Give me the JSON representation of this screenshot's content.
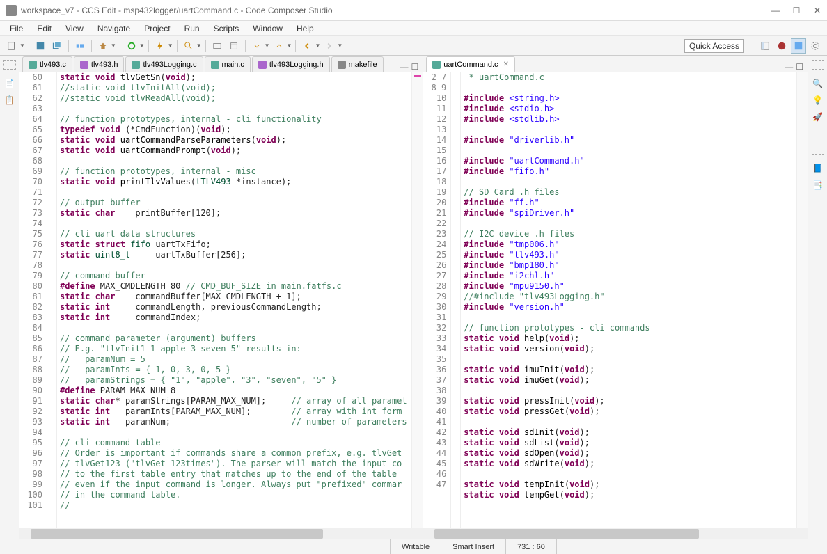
{
  "window": {
    "title": "workspace_v7 - CCS Edit - msp432logger/uartCommand.c - Code Composer Studio"
  },
  "menu": [
    "File",
    "Edit",
    "View",
    "Navigate",
    "Project",
    "Run",
    "Scripts",
    "Window",
    "Help"
  ],
  "quickAccess": "Quick Access",
  "tabs_left": [
    {
      "label": "tlv493.c",
      "t": "c"
    },
    {
      "label": "tlv493.h",
      "t": "h"
    },
    {
      "label": "tlv493Logging.c",
      "t": "c"
    },
    {
      "label": "main.c",
      "t": "c"
    },
    {
      "label": "tlv493Logging.h",
      "t": "h"
    },
    {
      "label": "makefile",
      "t": "mk"
    }
  ],
  "tabs_right": [
    {
      "label": "uartCommand.c",
      "t": "c",
      "active": true
    }
  ],
  "left_lines": [
    {
      "n": 60,
      "h": "<span class='kw'>static</span> <span class='kw'>void</span> <span class='fn'>tlvGetSn</span>(<span class='kw'>void</span>);"
    },
    {
      "n": 61,
      "h": "<span class='cm'>//static void tlvInitAll(void);</span>"
    },
    {
      "n": 62,
      "h": "<span class='cm'>//static void tlvReadAll(void);</span>"
    },
    {
      "n": 63,
      "h": ""
    },
    {
      "n": 64,
      "h": "<span class='cm'>// function prototypes, internal - cli functionality</span>"
    },
    {
      "n": 65,
      "h": "<span class='kw'>typedef</span> <span class='kw'>void</span> (*CmdFunction)(<span class='kw'>void</span>);"
    },
    {
      "n": 66,
      "h": "<span class='kw'>static</span> <span class='kw'>void</span> <span class='fn'>uartCommandParseParameters</span>(<span class='kw'>void</span>);"
    },
    {
      "n": 67,
      "h": "<span class='kw'>static</span> <span class='kw'>void</span> <span class='fn'>uartCommandPrompt</span>(<span class='kw'>void</span>);"
    },
    {
      "n": 68,
      "h": ""
    },
    {
      "n": 69,
      "h": "<span class='cm'>// function prototypes, internal - misc</span>"
    },
    {
      "n": 70,
      "h": "<span class='kw'>static</span> <span class='kw'>void</span> <span class='fn'>printTlvValues</span>(<span class='ty'>tTLV493</span> *instance);"
    },
    {
      "n": 71,
      "h": ""
    },
    {
      "n": 72,
      "h": "<span class='cm'>// output buffer</span>"
    },
    {
      "n": 73,
      "h": "<span class='kw'>static</span> <span class='kw'>char</span>    printBuffer[120];"
    },
    {
      "n": 74,
      "h": ""
    },
    {
      "n": 75,
      "h": "<span class='cm'>// cli uart data structures</span>"
    },
    {
      "n": 76,
      "h": "<span class='kw'>static</span> <span class='kw'>struct</span> <span class='ty'>fifo</span> uartTxFifo;"
    },
    {
      "n": 77,
      "h": "<span class='kw'>static</span> <span class='ty'>uint8_t</span>     uartTxBuffer[256];"
    },
    {
      "n": 78,
      "h": ""
    },
    {
      "n": 79,
      "h": "<span class='cm'>// command buffer</span>"
    },
    {
      "n": 80,
      "h": "<span class='pp'>#define</span> MAX_CMDLENGTH 80 <span class='cm'>// CMD_BUF_SIZE in main.fatfs.c</span>"
    },
    {
      "n": 81,
      "h": "<span class='kw'>static</span> <span class='kw'>char</span>    commandBuffer[MAX_CMDLENGTH + 1];"
    },
    {
      "n": 82,
      "h": "<span class='kw'>static</span> <span class='kw'>int</span>     commandLength, previousCommandLength;"
    },
    {
      "n": 83,
      "h": "<span class='kw'>static</span> <span class='kw'>int</span>     commandIndex;"
    },
    {
      "n": 84,
      "h": ""
    },
    {
      "n": 85,
      "h": "<span class='cm'>// command parameter (argument) buffers</span>"
    },
    {
      "n": 86,
      "h": "<span class='cm'>// E.g. \"tlvInit1 1 apple 3 seven 5\" results in:</span>"
    },
    {
      "n": 87,
      "h": "<span class='cm'>//   paramNum = 5</span>"
    },
    {
      "n": 88,
      "h": "<span class='cm'>//   paramInts = { 1, 0, 3, 0, 5 }</span>"
    },
    {
      "n": 89,
      "h": "<span class='cm'>//   paramStrings = { \"1\", \"apple\", \"3\", \"seven\", \"5\" }</span>"
    },
    {
      "n": 90,
      "h": "<span class='pp'>#define</span> PARAM_MAX_NUM 8"
    },
    {
      "n": 91,
      "h": "<span class='kw'>static</span> <span class='kw'>char</span>* paramStrings[PARAM_MAX_NUM];     <span class='cm'>// array of all paramet</span>"
    },
    {
      "n": 92,
      "h": "<span class='kw'>static</span> <span class='kw'>int</span>   paramInts[PARAM_MAX_NUM];        <span class='cm'>// array with int form</span>"
    },
    {
      "n": 93,
      "h": "<span class='kw'>static</span> <span class='kw'>int</span>   paramNum;                        <span class='cm'>// number of parameters</span>"
    },
    {
      "n": 94,
      "h": ""
    },
    {
      "n": 95,
      "h": "<span class='cm'>// cli command table</span>"
    },
    {
      "n": 96,
      "h": "<span class='cm'>// Order is important if commands share a common prefix, e.g. tlvGet</span>"
    },
    {
      "n": 97,
      "h": "<span class='cm'>// tlvGet123 (\"tlvGet 123times\"). The parser will match the input co</span>"
    },
    {
      "n": 98,
      "h": "<span class='cm'>// to the first table entry that matches up to the end of the table</span>"
    },
    {
      "n": 99,
      "h": "<span class='cm'>// even if the input command is longer. Always put \"prefixed\" commar</span>"
    },
    {
      "n": 100,
      "h": "<span class='cm'>// in the command table.</span>"
    },
    {
      "n": 101,
      "h": "<span class='cm'>//</span>"
    }
  ],
  "right_lines": [
    {
      "n": 2,
      "h": " <span class='cm'>* uartCommand.c</span>"
    },
    {
      "n": 7,
      "h": ""
    },
    {
      "n": 8,
      "h": "<span class='pp'>#include</span> <span class='st'>&lt;string.h&gt;</span>"
    },
    {
      "n": 9,
      "h": "<span class='pp'>#include</span> <span class='st'>&lt;stdio.h&gt;</span>"
    },
    {
      "n": 10,
      "h": "<span class='pp'>#include</span> <span class='st'>&lt;stdlib.h&gt;</span>"
    },
    {
      "n": 11,
      "h": ""
    },
    {
      "n": 12,
      "h": "<span class='pp'>#include</span> <span class='st'>\"driverlib.h\"</span>"
    },
    {
      "n": 13,
      "h": ""
    },
    {
      "n": 14,
      "h": "<span class='pp'>#include</span> <span class='st'>\"uartCommand.h\"</span>"
    },
    {
      "n": 15,
      "h": "<span class='pp'>#include</span> <span class='st'>\"fifo.h\"</span>"
    },
    {
      "n": 16,
      "h": ""
    },
    {
      "n": 17,
      "h": "<span class='cm'>// SD Card .h files</span>"
    },
    {
      "n": 18,
      "h": "<span class='pp'>#include</span> <span class='st'>\"ff.h\"</span>"
    },
    {
      "n": 19,
      "h": "<span class='pp'>#include</span> <span class='st'>\"spiDriver.h\"</span>"
    },
    {
      "n": 20,
      "h": ""
    },
    {
      "n": 21,
      "h": "<span class='cm'>// I2C device .h files</span>"
    },
    {
      "n": 22,
      "h": "<span class='pp'>#include</span> <span class='st'>\"tmp006.h\"</span>"
    },
    {
      "n": 23,
      "h": "<span class='pp'>#include</span> <span class='st'>\"tlv493.h\"</span>"
    },
    {
      "n": 24,
      "h": "<span class='pp'>#include</span> <span class='st'>\"bmp180.h\"</span>"
    },
    {
      "n": 25,
      "h": "<span class='pp'>#include</span> <span class='st'>\"i2chl.h\"</span>"
    },
    {
      "n": 26,
      "h": "<span class='pp'>#include</span> <span class='st'>\"mpu9150.h\"</span>"
    },
    {
      "n": 27,
      "h": "<span class='cm'>//#include \"tlv493Logging.h\"</span>"
    },
    {
      "n": 28,
      "h": "<span class='pp'>#include</span> <span class='st'>\"version.h\"</span>"
    },
    {
      "n": 29,
      "h": ""
    },
    {
      "n": 30,
      "h": "<span class='cm'>// function prototypes - cli commands</span>"
    },
    {
      "n": 31,
      "h": "<span class='kw'>static</span> <span class='kw'>void</span> <span class='fn'>help</span>(<span class='kw'>void</span>);"
    },
    {
      "n": 32,
      "h": "<span class='kw'>static</span> <span class='kw'>void</span> <span class='fn'>version</span>(<span class='kw'>void</span>);"
    },
    {
      "n": 33,
      "h": ""
    },
    {
      "n": 34,
      "h": "<span class='kw'>static</span> <span class='kw'>void</span> <span class='fn'>imuInit</span>(<span class='kw'>void</span>);"
    },
    {
      "n": 35,
      "h": "<span class='kw'>static</span> <span class='kw'>void</span> <span class='fn'>imuGet</span>(<span class='kw'>void</span>);"
    },
    {
      "n": 36,
      "h": ""
    },
    {
      "n": 37,
      "h": "<span class='kw'>static</span> <span class='kw'>void</span> <span class='fn'>pressInit</span>(<span class='kw'>void</span>);"
    },
    {
      "n": 38,
      "h": "<span class='kw'>static</span> <span class='kw'>void</span> <span class='fn'>pressGet</span>(<span class='kw'>void</span>);"
    },
    {
      "n": 39,
      "h": ""
    },
    {
      "n": 40,
      "h": "<span class='kw'>static</span> <span class='kw'>void</span> <span class='fn'>sdInit</span>(<span class='kw'>void</span>);"
    },
    {
      "n": 41,
      "h": "<span class='kw'>static</span> <span class='kw'>void</span> <span class='fn'>sdList</span>(<span class='kw'>void</span>);"
    },
    {
      "n": 42,
      "h": "<span class='kw'>static</span> <span class='kw'>void</span> <span class='fn'>sdOpen</span>(<span class='kw'>void</span>);"
    },
    {
      "n": 43,
      "h": "<span class='kw'>static</span> <span class='kw'>void</span> <span class='fn'>sdWrite</span>(<span class='kw'>void</span>);"
    },
    {
      "n": 44,
      "h": ""
    },
    {
      "n": 45,
      "h": "<span class='kw'>static</span> <span class='kw'>void</span> <span class='fn'>tempInit</span>(<span class='kw'>void</span>);"
    },
    {
      "n": 46,
      "h": "<span class='kw'>static</span> <span class='kw'>void</span> <span class='fn'>tempGet</span>(<span class='kw'>void</span>);"
    },
    {
      "n": 47,
      "h": ""
    }
  ],
  "status": {
    "writable": "Writable",
    "insert": "Smart Insert",
    "pos": "731 : 60"
  }
}
